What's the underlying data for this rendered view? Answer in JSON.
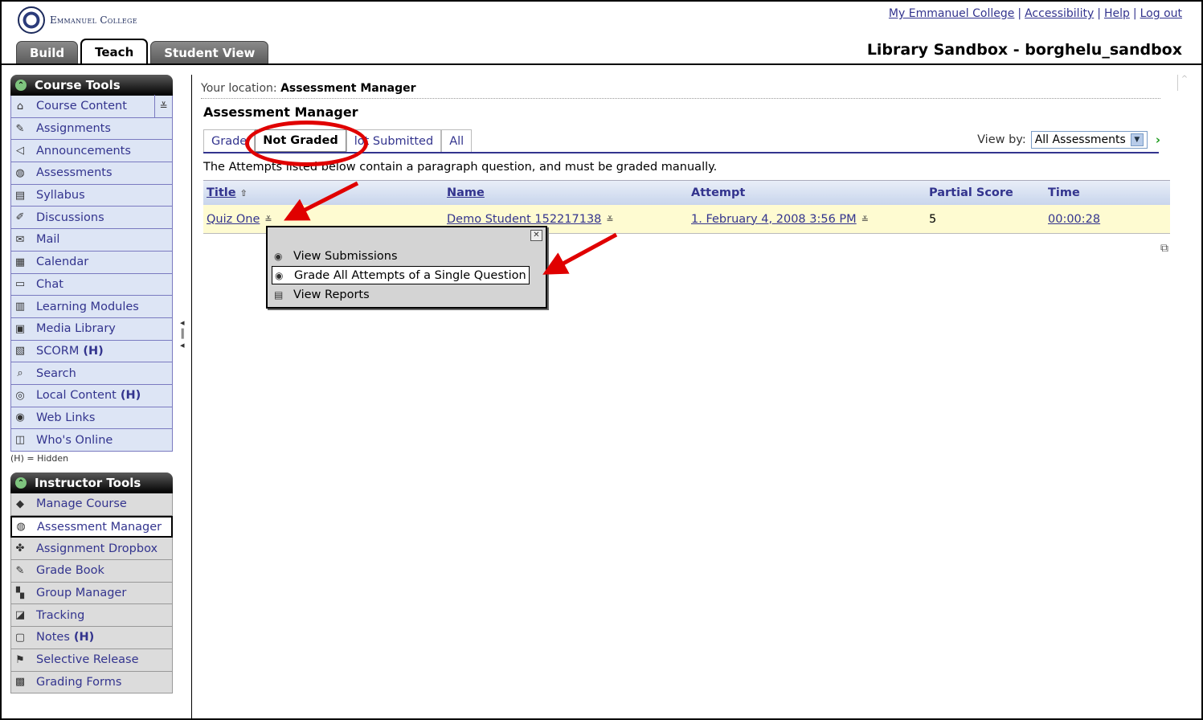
{
  "header": {
    "college_name": "Emmanuel College",
    "top_links": [
      "My Emmanuel College",
      "Accessibility",
      "Help",
      "Log out"
    ],
    "course_title": "Library Sandbox - borghelu_sandbox",
    "tabs": [
      "Build",
      "Teach",
      "Student View"
    ],
    "active_tab": "Teach"
  },
  "sidebar": {
    "course_tools_title": "Course Tools",
    "course_tools": [
      {
        "label": "Course Content",
        "icon": "home-icon"
      },
      {
        "label": "Assignments",
        "icon": "assignment-icon"
      },
      {
        "label": "Announcements",
        "icon": "megaphone-icon"
      },
      {
        "label": "Assessments",
        "icon": "assessment-icon"
      },
      {
        "label": "Syllabus",
        "icon": "syllabus-icon"
      },
      {
        "label": "Discussions",
        "icon": "discussion-icon"
      },
      {
        "label": "Mail",
        "icon": "mail-icon"
      },
      {
        "label": "Calendar",
        "icon": "calendar-icon"
      },
      {
        "label": "Chat",
        "icon": "chat-icon"
      },
      {
        "label": "Learning Modules",
        "icon": "module-icon"
      },
      {
        "label": "Media Library",
        "icon": "media-icon"
      },
      {
        "label": "SCORM",
        "icon": "scorm-icon",
        "hidden_marker": "(H)"
      },
      {
        "label": "Search",
        "icon": "search-icon"
      },
      {
        "label": "Local Content",
        "icon": "disc-icon",
        "hidden_marker": "(H)"
      },
      {
        "label": "Web Links",
        "icon": "globe-icon"
      },
      {
        "label": "Who's Online",
        "icon": "people-icon"
      }
    ],
    "hidden_note": "(H) = Hidden",
    "instructor_tools_title": "Instructor Tools",
    "instructor_tools": [
      {
        "label": "Manage Course",
        "icon": "toolbox-icon"
      },
      {
        "label": "Assessment Manager",
        "icon": "assessment-icon",
        "selected": true
      },
      {
        "label": "Assignment Dropbox",
        "icon": "dropbox-icon"
      },
      {
        "label": "Grade Book",
        "icon": "gradebook-icon"
      },
      {
        "label": "Group Manager",
        "icon": "group-icon"
      },
      {
        "label": "Tracking",
        "icon": "chart-icon"
      },
      {
        "label": "Notes",
        "icon": "notes-icon",
        "hidden_marker": "(H)"
      },
      {
        "label": "Selective Release",
        "icon": "release-icon"
      },
      {
        "label": "Grading Forms",
        "icon": "form-icon"
      }
    ]
  },
  "main": {
    "location_label": "Your location:",
    "location_value": "Assessment Manager",
    "page_title": "Assessment Manager",
    "subtabs": [
      "Graded",
      "Not Graded",
      "Not Submitted",
      "All"
    ],
    "subtab_visible_labels": [
      "Grade",
      "Not Graded",
      "lot Submitted",
      "All"
    ],
    "active_subtab": "Not Graded",
    "view_by_label": "View by:",
    "view_by_value": "All Assessments",
    "intro_text": "The Attempts listed below contain a paragraph question, and must be graded manually.",
    "table": {
      "columns": [
        "Title",
        "Name",
        "Attempt",
        "Partial Score",
        "Time"
      ],
      "rows": [
        {
          "title": "Quiz One",
          "name": "Demo Student 152217138",
          "attempt": "1. February 4, 2008 3:56 PM",
          "partial_score": "5",
          "time": "00:00:28"
        }
      ]
    },
    "popup_menu": {
      "items": [
        "View Submissions",
        "Grade All Attempts of a Single Question",
        "View Reports"
      ],
      "focused_item": "Grade All Attempts of a Single Question"
    }
  },
  "annotation_colors": {
    "highlight": "#e00000",
    "link": "#33348e",
    "row_bg": "#fefbd1"
  }
}
